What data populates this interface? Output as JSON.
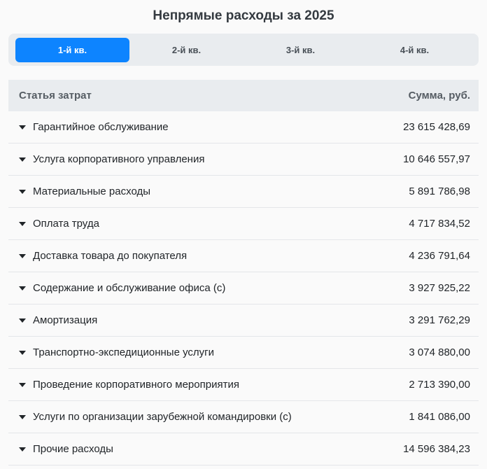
{
  "title": "Непрямые расходы за 2025",
  "tabs": [
    {
      "label": "1-й кв.",
      "active": true
    },
    {
      "label": "2-й кв.",
      "active": false
    },
    {
      "label": "3-й кв.",
      "active": false
    },
    {
      "label": "4-й кв.",
      "active": false
    }
  ],
  "table": {
    "headers": {
      "item": "Статья затрат",
      "amount": "Сумма, руб."
    },
    "rows": [
      {
        "item": "Гарантийное обслуживание",
        "amount": "23 615 428,69"
      },
      {
        "item": "Услуга корпоративного управления",
        "amount": "10 646 557,97"
      },
      {
        "item": "Материальные расходы",
        "amount": "5 891 786,98"
      },
      {
        "item": "Оплата труда",
        "amount": "4 717 834,52"
      },
      {
        "item": "Доставка товара до покупателя",
        "amount": "4 236 791,64"
      },
      {
        "item": "Содержание и обслуживание офиса (с)",
        "amount": "3 927 925,22"
      },
      {
        "item": "Амортизация",
        "amount": "3 291 762,29"
      },
      {
        "item": "Транспортно-экспедиционные услуги",
        "amount": "3 074 880,00"
      },
      {
        "item": "Проведение корпоративного мероприятия",
        "amount": "2 713 390,00"
      },
      {
        "item": "Услуги по организации зарубежной командировки (с)",
        "amount": "1 841 086,00"
      },
      {
        "item": "Прочие расходы",
        "amount": "14 596 384,23"
      }
    ]
  },
  "icons": {
    "row_toggle": "caret-down-icon"
  },
  "colors": {
    "accent": "#0d84ff",
    "header_bg": "#e9ecef"
  }
}
